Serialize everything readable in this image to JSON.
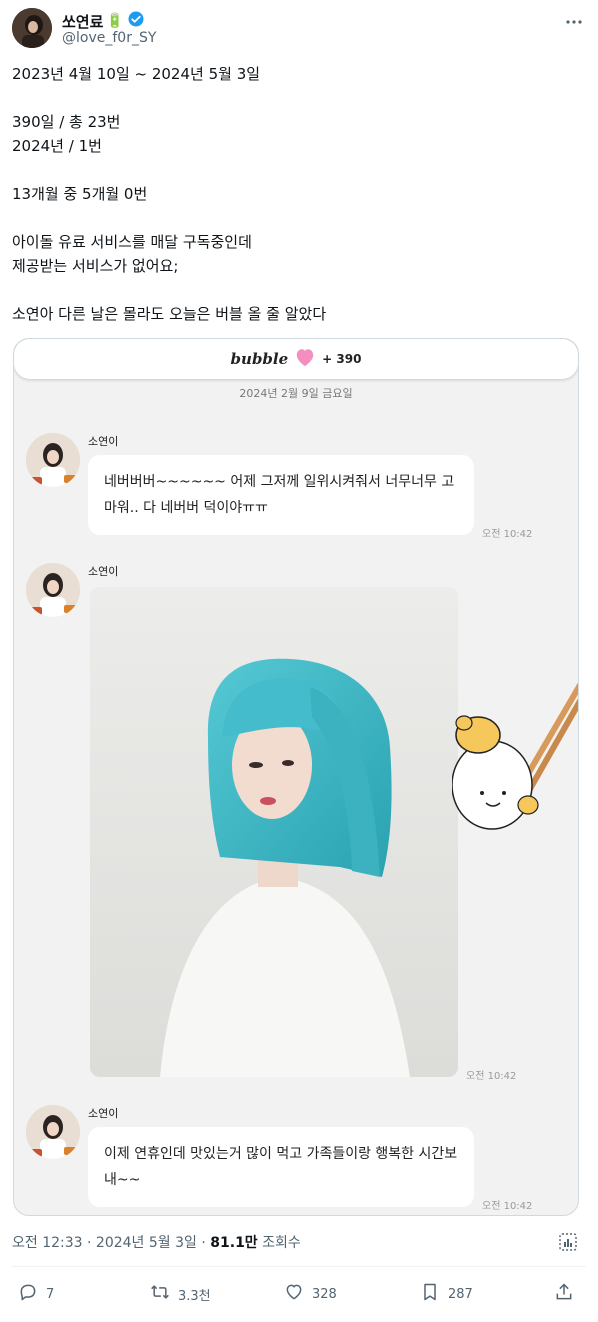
{
  "author": {
    "display_name": "쏘연료",
    "handle": "@love_f0r_SY",
    "badge_emoji": "🔋"
  },
  "tweet": {
    "text": "2023년 4월 10일 ~ 2024년 5월 3일\n\n390일 / 총 23번\n2024년 / 1번\n\n13개월 중 5개월 0번\n\n아이돌 유료 서비스를 매달 구독중인데\n제공받는 서비스가 없어요;\n\n소연아 다른 날은 몰라도 오늘은 버블 올 줄 알았다"
  },
  "card": {
    "logo_text": "bubble",
    "plus_count": "+ 390",
    "date_separator": "2024년 2월 9일 금요일",
    "messages": [
      {
        "sender": "소연이",
        "text": "네버버버~~~~~~ 어제 그저께 일위시켜줘서 너무너무 고마워.. 다 네버버 덕이야ㅠㅠ",
        "time": "오전 10:42"
      },
      {
        "sender": "소연이",
        "type": "photo",
        "time": "오전 10:42"
      },
      {
        "sender": "소연이",
        "text": "이제 연휴인데 맛있는거 많이 먹고 가족들이랑 행복한 시간보내~~",
        "time": "오전 10:42"
      }
    ]
  },
  "meta": {
    "time": "오전 12:33",
    "sep1": " · ",
    "date": "2024년 5월 3일",
    "sep2": " · ",
    "views_count": "81.1만",
    "views_label": " 조회수"
  },
  "actions": {
    "reply_count": "7",
    "retweet_count": "3.3천",
    "like_count": "328",
    "bookmark_count": "287"
  },
  "colors": {
    "verified": "#1d9bf0",
    "secondary_text": "#536471",
    "hair": "#3fb7c4",
    "heart": "#f58ec0"
  },
  "icons": [
    "more-icon",
    "verified-icon",
    "views-analytics-icon",
    "reply-icon",
    "retweet-icon",
    "like-icon",
    "bookmark-icon",
    "share-icon",
    "heart-icon"
  ]
}
